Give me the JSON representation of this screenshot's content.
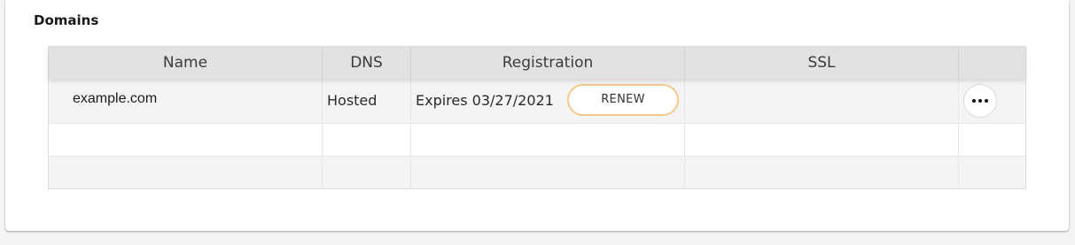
{
  "section": {
    "title": "Domains"
  },
  "table": {
    "columns": [
      "Name",
      "DNS",
      "Registration",
      "SSL",
      ""
    ],
    "rows": [
      {
        "name": "example.com",
        "dns": "Hosted",
        "registration": "Expires 03/27/2021",
        "renew_label": "RENEW",
        "ssl": "",
        "actions_icon": "more-horizontal-icon"
      }
    ]
  },
  "colors": {
    "renew_border": "#f5c98a",
    "header_bg": "#e2e2e2",
    "row_alt_bg": "#f4f4f4"
  }
}
